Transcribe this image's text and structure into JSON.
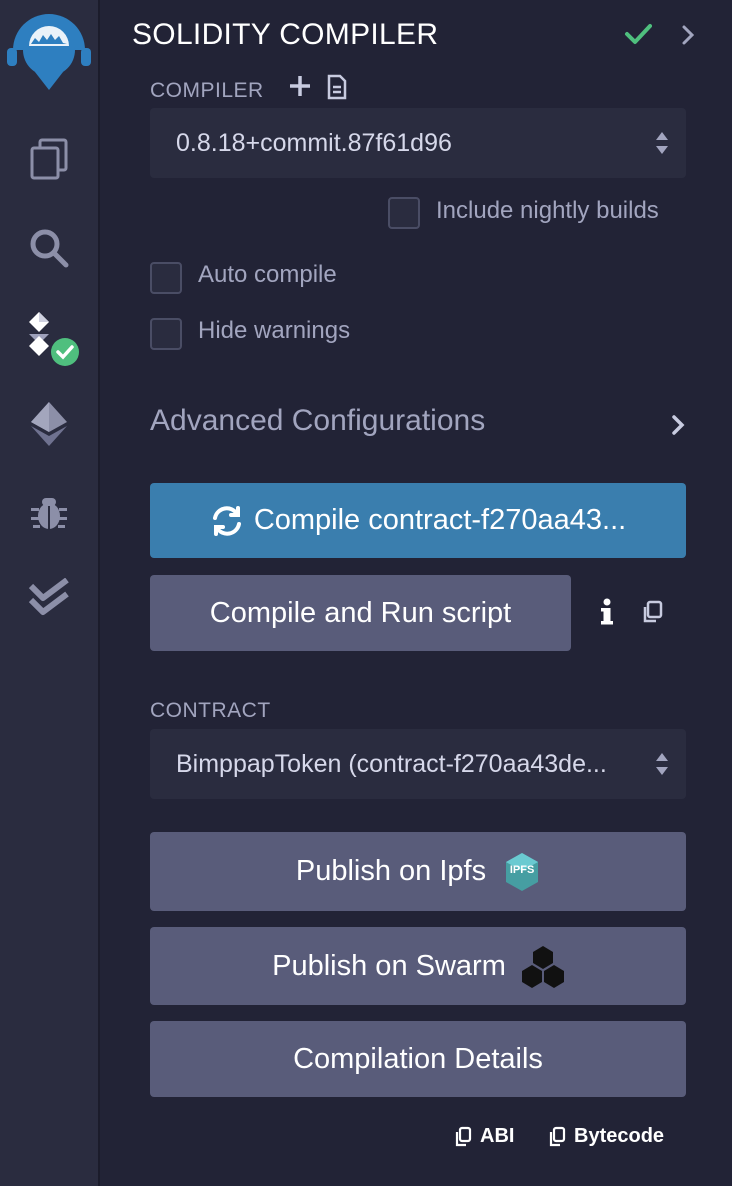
{
  "header": {
    "title": "SOLIDITY COMPILER"
  },
  "compiler": {
    "label": "COMPILER",
    "version": "0.8.18+commit.87f61d96",
    "include_nightly_label": "Include nightly builds"
  },
  "options": {
    "auto_compile_label": "Auto compile",
    "hide_warnings_label": "Hide warnings"
  },
  "advanced": {
    "label": "Advanced Configurations"
  },
  "buttons": {
    "compile_label": "Compile contract-f270aa43...",
    "compile_run_label": "Compile and Run script",
    "publish_ipfs_label": "Publish on Ipfs",
    "publish_swarm_label": "Publish on Swarm",
    "details_label": "Compilation Details"
  },
  "contract": {
    "label": "CONTRACT",
    "selected": "BimppapToken (contract-f270aa43de..."
  },
  "ipfs_badge": "IPFS",
  "footer": {
    "abi_label": "ABI",
    "bytecode_label": "Bytecode"
  },
  "colors": {
    "accent": "#3a7eae",
    "success": "#4fbf7e",
    "button": "#595c7a",
    "background": "#222336"
  },
  "icons": [
    "remix-logo-icon",
    "file-explorer-icon",
    "search-icon",
    "solidity-compiler-icon",
    "deploy-run-icon",
    "debugger-icon",
    "test-icon",
    "check-icon",
    "chevron-right-icon",
    "plus-icon",
    "file-icon",
    "sort-arrows-icon",
    "refresh-icon",
    "info-icon",
    "copy-icon",
    "ipfs-icon",
    "swarm-icon"
  ]
}
